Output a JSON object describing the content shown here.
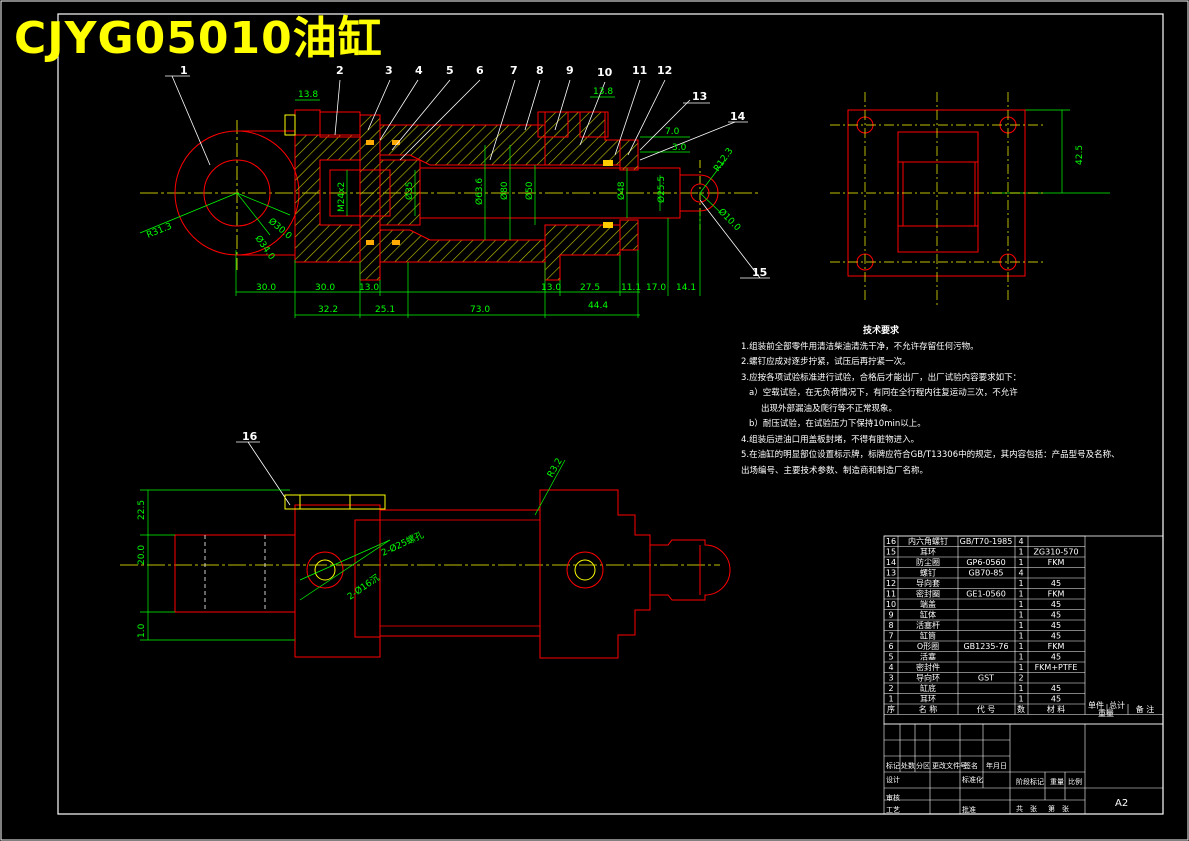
{
  "title": "CJYG05010油缸",
  "sheet_size": "A2",
  "part_callouts": [
    "1",
    "2",
    "3",
    "4",
    "5",
    "6",
    "7",
    "8",
    "9",
    "10",
    "11",
    "12",
    "13",
    "14",
    "15",
    "16"
  ],
  "top_dims": {
    "d1": "13.8",
    "d2": "13.8",
    "d3": "7.0",
    "d4": "3.0",
    "r1": "R12.3",
    "r2": "R31.3",
    "dia1": "Ø30.0",
    "dia2": "Ø34.0",
    "dia3": "Ø10.0",
    "dia_a": "M24x2",
    "dia_b": "Ø35",
    "dia_c": "Ø63.6",
    "dia_d": "Ø80",
    "dia_e": "Ø50",
    "dia_f": "Ø48",
    "dia_g": "Ø25.5"
  },
  "bottom_dims_row1": [
    "30.0",
    "30.0",
    "13.0",
    "13.0",
    "27.5",
    "11.1",
    "17.0",
    "14.1"
  ],
  "bottom_dims_row2": [
    "32.2",
    "25.1",
    "73.0",
    "44.4"
  ],
  "side_dim": "42.5",
  "lower_view": {
    "d1": "22.5",
    "d2": "20.0",
    "d3": "1.0",
    "r": "R3.2",
    "label1": "2-Ø25螺孔",
    "label2": "2-Ø16沉"
  },
  "tech_notes": {
    "heading": "技术要求",
    "lines": [
      "1.组装前全部零件用清洁柴油清洗干净，不允许存留任何污物。",
      "2.螺钉应成对逐步拧紧，试压后再拧紧一次。",
      "3.应按各项试验标准进行试验，合格后才能出厂，出厂试验内容要求如下：",
      "  a）空载试验，在无负荷情况下，有同在全行程内往复运动三次，不允许",
      "     出现外部漏油及爬行等不正常现象。",
      "  b）耐压试验，在试验压力下保持10min以上。",
      "4.组装后进油口用盖板封堵，不得有脏物进入。",
      "5.在油缸的明显部位设置标示牌，标牌应符合GB/T13306中的规定，其内容包括：产品型号及名称、",
      "出场编号、主要技术参数、制造商和制造厂名称。"
    ]
  },
  "bom": {
    "header": [
      "序",
      "名  称",
      "代  号",
      "数",
      "材  料",
      "单件",
      "总计",
      "备  注"
    ],
    "rows": [
      {
        "no": "16",
        "name": "内六角螺钉",
        "code": "GB/T70-1985",
        "qty": "4",
        "mat": ""
      },
      {
        "no": "15",
        "name": "耳环",
        "code": "",
        "qty": "1",
        "mat": "ZG310-570"
      },
      {
        "no": "14",
        "name": "防尘圈",
        "code": "GP6-0560",
        "qty": "1",
        "mat": "FKM"
      },
      {
        "no": "13",
        "name": "螺钉",
        "code": "GB70-85",
        "qty": "4",
        "mat": ""
      },
      {
        "no": "12",
        "name": "导向套",
        "code": "",
        "qty": "1",
        "mat": "45"
      },
      {
        "no": "11",
        "name": "密封圈",
        "code": "GE1-0560",
        "qty": "1",
        "mat": "FKM"
      },
      {
        "no": "10",
        "name": "端盖",
        "code": "",
        "qty": "1",
        "mat": "45"
      },
      {
        "no": "9",
        "name": "缸体",
        "code": "",
        "qty": "1",
        "mat": "45"
      },
      {
        "no": "8",
        "name": "活塞杆",
        "code": "",
        "qty": "1",
        "mat": "45"
      },
      {
        "no": "7",
        "name": "缸筒",
        "code": "",
        "qty": "1",
        "mat": "45"
      },
      {
        "no": "6",
        "name": "O形圈",
        "code": "GB1235-76",
        "qty": "1",
        "mat": "FKM"
      },
      {
        "no": "5",
        "name": "活塞",
        "code": "",
        "qty": "1",
        "mat": "45"
      },
      {
        "no": "4",
        "name": "密封件",
        "code": "",
        "qty": "1",
        "mat": "FKM+PTFE"
      },
      {
        "no": "3",
        "name": "导向环",
        "code": "GST",
        "qty": "2",
        "mat": ""
      },
      {
        "no": "2",
        "name": "缸底",
        "code": "",
        "qty": "1",
        "mat": "45"
      },
      {
        "no": "1",
        "name": "耳环",
        "code": "",
        "qty": "1",
        "mat": "45"
      }
    ],
    "weight_labels": [
      "单件",
      "总计"
    ],
    "weight_sublabel": "重量"
  },
  "title_block": {
    "row1": [
      "标记",
      "处数",
      "分区",
      "更改文件号",
      "签名",
      "年月日"
    ],
    "row2": [
      "设计",
      "",
      "标准化",
      ""
    ],
    "row3": [
      "审核"
    ],
    "row4": [
      "工艺",
      "",
      "批准"
    ],
    "stage_labels": [
      "阶段标记",
      "重量",
      "比例"
    ],
    "sheet_labels": [
      "共",
      "张",
      "第",
      "张"
    ]
  },
  "colors": {
    "background": "#000000",
    "outline": "#ff0000",
    "dimension": "#00ff00",
    "centerline": "#ffff00",
    "hatch": "#ffff00",
    "text": "#ffffff",
    "title": "#ffff00",
    "border": "#ffffff"
  }
}
